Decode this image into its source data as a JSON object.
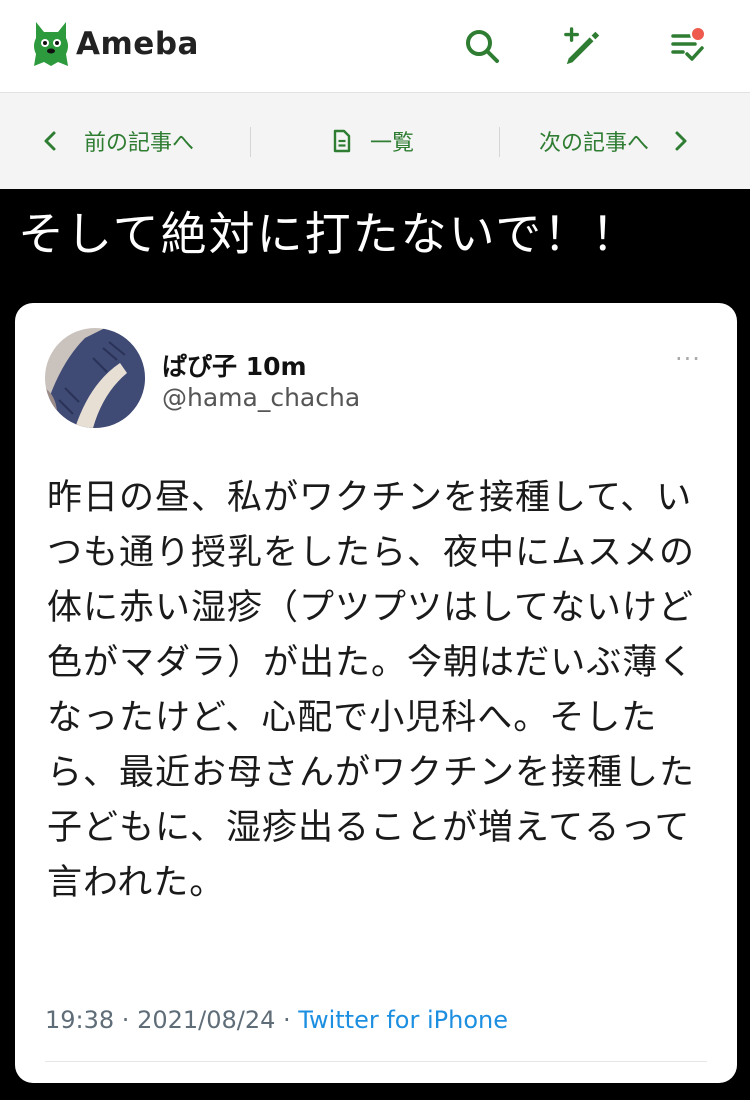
{
  "header": {
    "logo_text": "Ameba",
    "icons": [
      "search-icon",
      "write-icon",
      "feed-icon"
    ],
    "accent_color": "#2e7d32",
    "notification_dot_color": "#ee5a4d"
  },
  "nav": {
    "prev_label": "前の記事へ",
    "list_label": "一覧",
    "next_label": "次の記事へ"
  },
  "article": {
    "headline": "そして絶対に打たないで！！"
  },
  "tweet": {
    "display_name": "ぱぴ子 10m",
    "handle": "@hama_chacha",
    "more_label": "···",
    "text": "昨日の昼、私がワクチンを接種して、いつも通り授乳をしたら、夜中にムスメの体に赤い湿疹（プツプツはしてないけど色がマダラ）が出た。今朝はだいぶ薄くなったけど、心配で小児科へ。そしたら、最近お母さんがワクチンを接種した子どもに、湿疹出ることが増えてるって言われた。",
    "time": "19:38",
    "date": "2021/08/24",
    "separator": " · ",
    "source": "Twitter for iPhone"
  }
}
